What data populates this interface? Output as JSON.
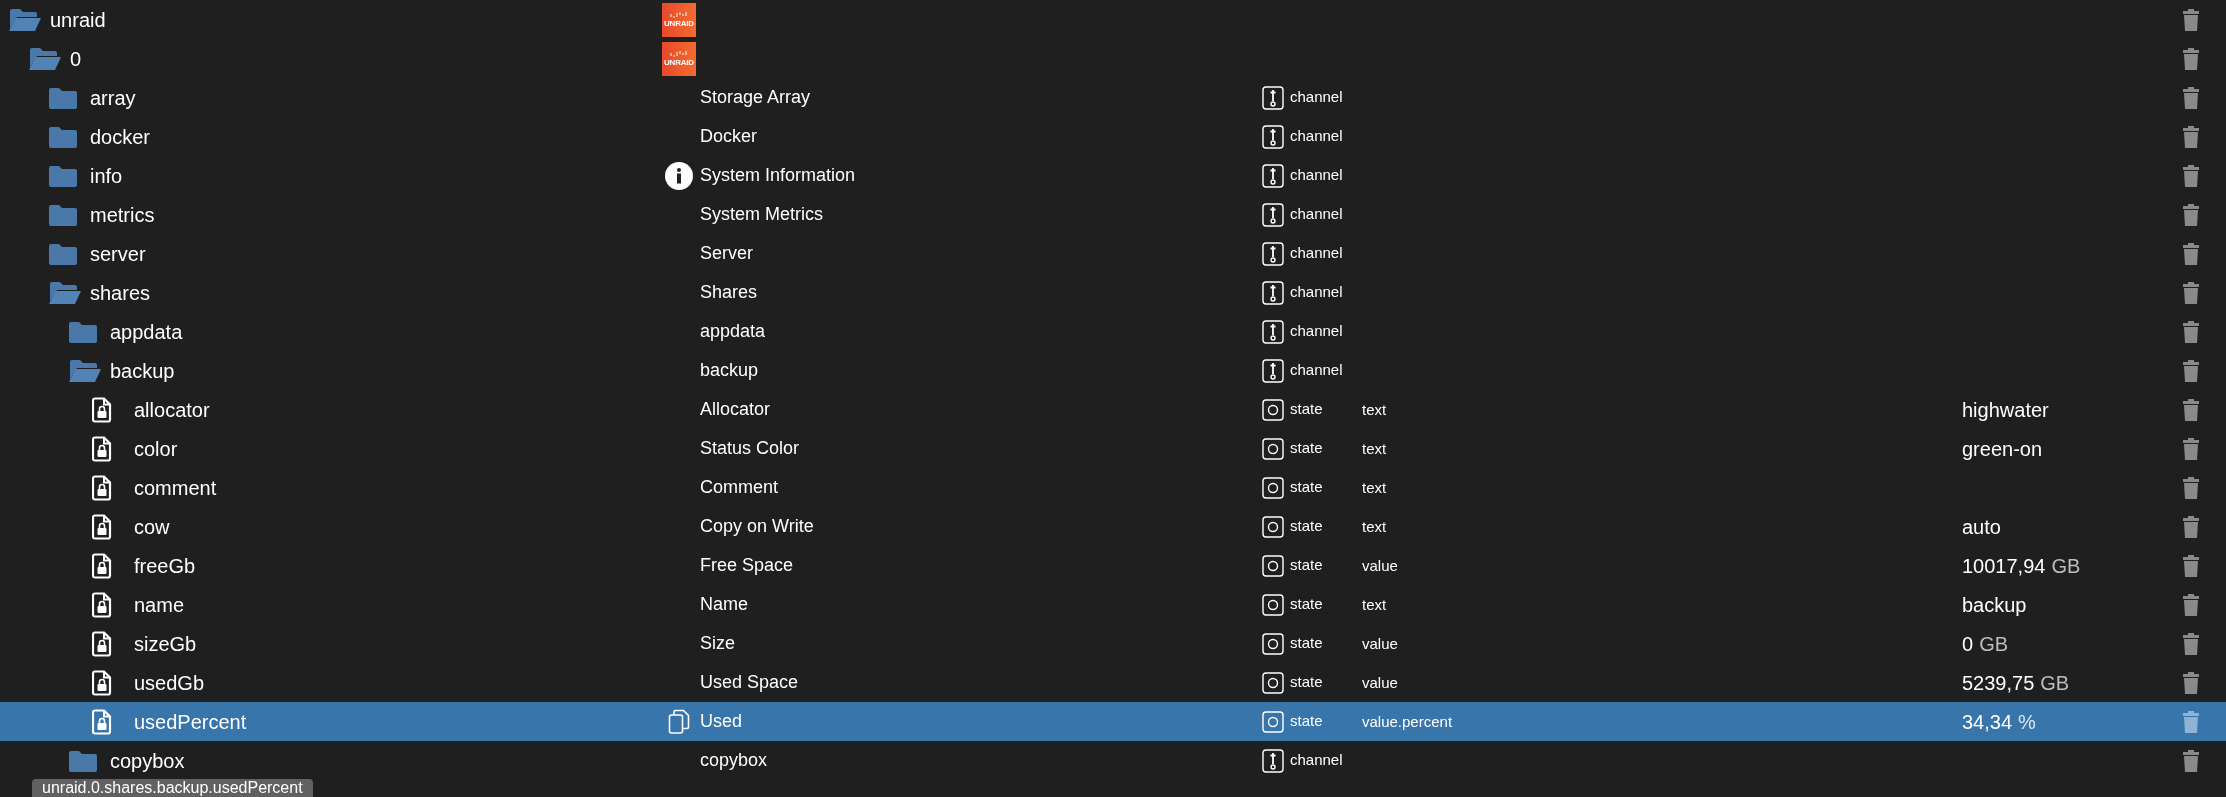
{
  "tree": [
    {
      "name": "unraid",
      "kind": "folder",
      "expanded": true,
      "selected": false,
      "icon": {
        "kind": "logo",
        "label": "UNRAID"
      },
      "children": [
        {
          "name": "0",
          "kind": "folder",
          "expanded": true,
          "selected": false,
          "icon": {
            "kind": "logo",
            "label": "UNRAID"
          },
          "children": [
            {
              "name": "array",
              "kind": "folder",
              "expanded": false,
              "selected": false,
              "description": "Storage Array",
              "type": "channel"
            },
            {
              "name": "docker",
              "kind": "folder",
              "expanded": false,
              "selected": false,
              "description": "Docker",
              "type": "channel"
            },
            {
              "name": "info",
              "kind": "folder",
              "expanded": false,
              "selected": false,
              "icon": {
                "kind": "info"
              },
              "description": "System Information",
              "type": "channel"
            },
            {
              "name": "metrics",
              "kind": "folder",
              "expanded": false,
              "selected": false,
              "description": "System Metrics",
              "type": "channel"
            },
            {
              "name": "server",
              "kind": "folder",
              "expanded": false,
              "selected": false,
              "description": "Server",
              "type": "channel"
            },
            {
              "name": "shares",
              "kind": "folder",
              "expanded": true,
              "selected": false,
              "description": "Shares",
              "type": "channel",
              "children": [
                {
                  "name": "appdata",
                  "kind": "folder",
                  "expanded": false,
                  "selected": false,
                  "description": "appdata",
                  "type": "channel"
                },
                {
                  "name": "backup",
                  "kind": "folder",
                  "expanded": true,
                  "selected": false,
                  "description": "backup",
                  "type": "channel",
                  "children": [
                    {
                      "name": "allocator",
                      "kind": "state",
                      "selected": false,
                      "description": "Allocator",
                      "type": "state",
                      "role": "text",
                      "value": "highwater"
                    },
                    {
                      "name": "color",
                      "kind": "state",
                      "selected": false,
                      "description": "Status Color",
                      "type": "state",
                      "role": "text",
                      "value": "green-on"
                    },
                    {
                      "name": "comment",
                      "kind": "state",
                      "selected": false,
                      "description": "Comment",
                      "type": "state",
                      "role": "text"
                    },
                    {
                      "name": "cow",
                      "kind": "state",
                      "selected": false,
                      "description": "Copy on Write",
                      "type": "state",
                      "role": "text",
                      "value": "auto"
                    },
                    {
                      "name": "freeGb",
                      "kind": "state",
                      "selected": false,
                      "description": "Free Space",
                      "type": "state",
                      "role": "value",
                      "value": "10017,94",
                      "unit": "GB"
                    },
                    {
                      "name": "name",
                      "kind": "state",
                      "selected": false,
                      "description": "Name",
                      "type": "state",
                      "role": "text",
                      "value": "backup"
                    },
                    {
                      "name": "sizeGb",
                      "kind": "state",
                      "selected": false,
                      "description": "Size",
                      "type": "state",
                      "role": "value",
                      "value": "0",
                      "unit": "GB"
                    },
                    {
                      "name": "usedGb",
                      "kind": "state",
                      "selected": false,
                      "description": "Used Space",
                      "type": "state",
                      "role": "value",
                      "value": "5239,75",
                      "unit": "GB"
                    },
                    {
                      "name": "usedPercent",
                      "kind": "state",
                      "selected": true,
                      "icon": {
                        "kind": "copy"
                      },
                      "description": "Used",
                      "type": "state",
                      "role": "value.percent",
                      "value": "34,34",
                      "unit": "%"
                    }
                  ]
                },
                {
                  "name": "copybox",
                  "kind": "folder",
                  "expanded": false,
                  "selected": false,
                  "description": "copybox",
                  "type": "channel"
                }
              ]
            }
          ]
        }
      ]
    }
  ],
  "tooltip": "unraid.0.shares.backup.usedPercent"
}
